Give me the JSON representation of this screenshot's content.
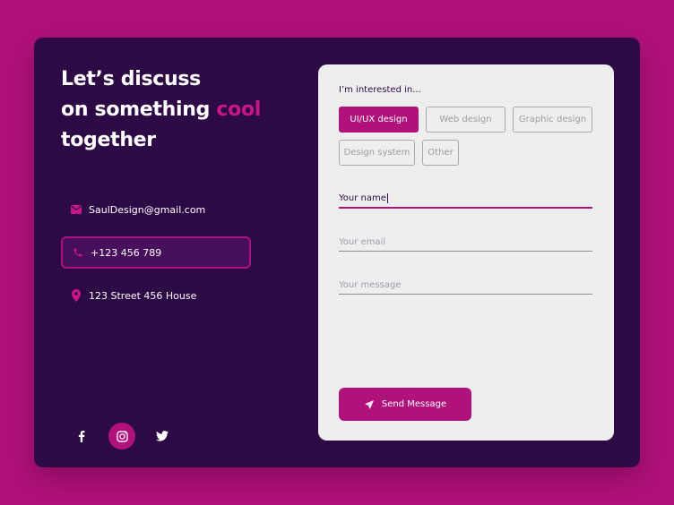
{
  "headline": {
    "line1": "Let’s discuss",
    "line2_prefix": "on something ",
    "line2_accent": "cool",
    "line3": "together"
  },
  "contacts": [
    {
      "icon": "mail-icon",
      "text": "SaulDesign@gmail.com"
    },
    {
      "icon": "phone-icon",
      "text": "+123 456 789"
    },
    {
      "icon": "location-pin-icon",
      "text": "123 Street 456 House"
    }
  ],
  "socials": [
    "facebook-icon",
    "instagram-icon",
    "twitter-icon"
  ],
  "form": {
    "interest_label": "I’m interested in...",
    "chips": [
      "UI/UX design",
      "Web design",
      "Graphic design",
      "Design system",
      "Other"
    ],
    "selected_chip": "UI/UX design",
    "fields": {
      "name": "Your name",
      "email": "Your email",
      "message": "Your message"
    },
    "send_label": "Send Message"
  },
  "colors": {
    "background": "#b0117a",
    "card": "#2d0a46",
    "accent": "#c8168a",
    "form": "#eeeeef"
  }
}
